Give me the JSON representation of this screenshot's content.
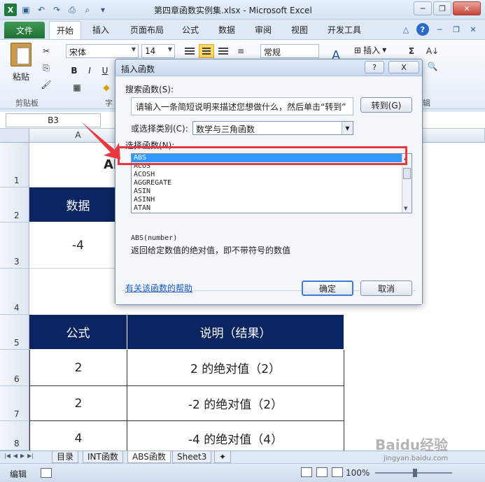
{
  "window": {
    "title": "第四章函数实例集.xlsx - Microsoft Excel"
  },
  "tabs": {
    "file": "文件",
    "items": [
      "开始",
      "插入",
      "页面布局",
      "公式",
      "数据",
      "审阅",
      "视图",
      "开发工具"
    ]
  },
  "ribbon": {
    "paste": "粘贴",
    "clipboard_group": "剪贴板",
    "font_group_partial": "字",
    "font_name": "宋体",
    "font_size": "14",
    "number_format": "常规",
    "insert": "插入",
    "edit_group_partial": "辑"
  },
  "formula_bar": {
    "name_box": "B3"
  },
  "grid": {
    "col_a": "A",
    "rows": [
      "1",
      "2",
      "3",
      "4",
      "5",
      "6",
      "7",
      "8"
    ],
    "title_partial": "Al",
    "header_data": "数据",
    "value_a3": "-4",
    "header_formula": "公式",
    "header_desc": "说明（结果）",
    "r6": {
      "a": "2",
      "b": "2 的绝对值（2）"
    },
    "r7": {
      "a": "2",
      "b": "-2 的绝对值（2）"
    },
    "r8": {
      "a": "4",
      "b": "-4 的绝对值（4）"
    }
  },
  "sheets": [
    "目录",
    "INT函数",
    "ABS函数",
    "Sheet3"
  ],
  "status": {
    "mode": "编辑",
    "zoom": "100%"
  },
  "dialog": {
    "title": "插入函数",
    "help_btn": "?",
    "close_btn": "X",
    "search_label": "搜索函数(S):",
    "search_value": "请输入一条简短说明来描述您想做什么，然后单击“转到”",
    "goto": "转到(G)",
    "category_label": "或选择类别(C):",
    "category_value": "数学与三角函数",
    "select_label": "选择函数(N):",
    "functions": [
      "ABS",
      "ACOS",
      "ACOSH",
      "AGGREGATE",
      "ASIN",
      "ASINH",
      "ATAN"
    ],
    "syntax": "ABS(number)",
    "description": "返回给定数值的绝对值，即不带符号的数值",
    "help_link": "有关该函数的帮助",
    "ok": "确定",
    "cancel": "取消"
  },
  "watermark": {
    "main": "Baidu经验",
    "sub": "jingyan.baidu.com"
  }
}
